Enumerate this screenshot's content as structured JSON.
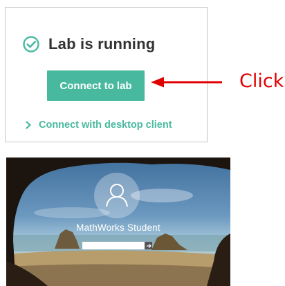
{
  "lab_card": {
    "status_text": "Lab is running",
    "status_icon": "check-circle-icon",
    "connect_button_label": "Connect to lab",
    "desktop_client_link_label": "Connect with desktop client",
    "link_icon": "chevron-right-icon"
  },
  "annotation": {
    "label": "Click",
    "icon": "arrow-left-icon"
  },
  "lock_screen": {
    "user_icon": "user-icon",
    "username": "MathWorks Student",
    "password_value": "",
    "submit_icon": "arrow-right-icon"
  },
  "colors": {
    "accent": "#48b99f",
    "annotation": "#e10000",
    "status_text": "#333333"
  }
}
